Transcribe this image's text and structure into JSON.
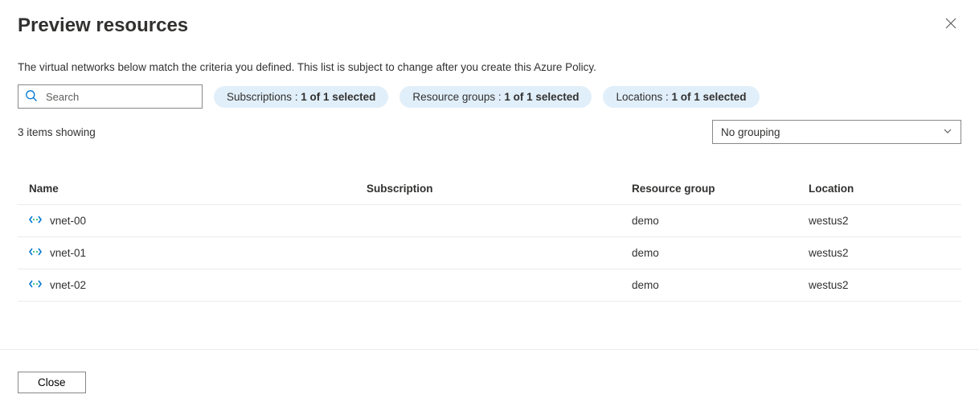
{
  "header": {
    "title": "Preview resources"
  },
  "description": "The virtual networks below match the criteria you defined. This list is subject to change after you create this Azure Policy.",
  "search": {
    "placeholder": "Search",
    "value": ""
  },
  "filters": {
    "subscriptions": {
      "label": "Subscriptions : ",
      "selection": "1 of 1 selected"
    },
    "resource_groups": {
      "label": "Resource groups : ",
      "selection": "1 of 1 selected"
    },
    "locations": {
      "label": "Locations : ",
      "selection": "1 of 1 selected"
    }
  },
  "results": {
    "count_text": "3 items showing",
    "grouping": "No grouping"
  },
  "table": {
    "columns": {
      "name": "Name",
      "subscription": "Subscription",
      "resource_group": "Resource group",
      "location": "Location"
    },
    "rows": [
      {
        "name": "vnet-00",
        "subscription": "",
        "resource_group": "demo",
        "location": "westus2"
      },
      {
        "name": "vnet-01",
        "subscription": "",
        "resource_group": "demo",
        "location": "westus2"
      },
      {
        "name": "vnet-02",
        "subscription": "",
        "resource_group": "demo",
        "location": "westus2"
      }
    ]
  },
  "footer": {
    "close_label": "Close"
  }
}
